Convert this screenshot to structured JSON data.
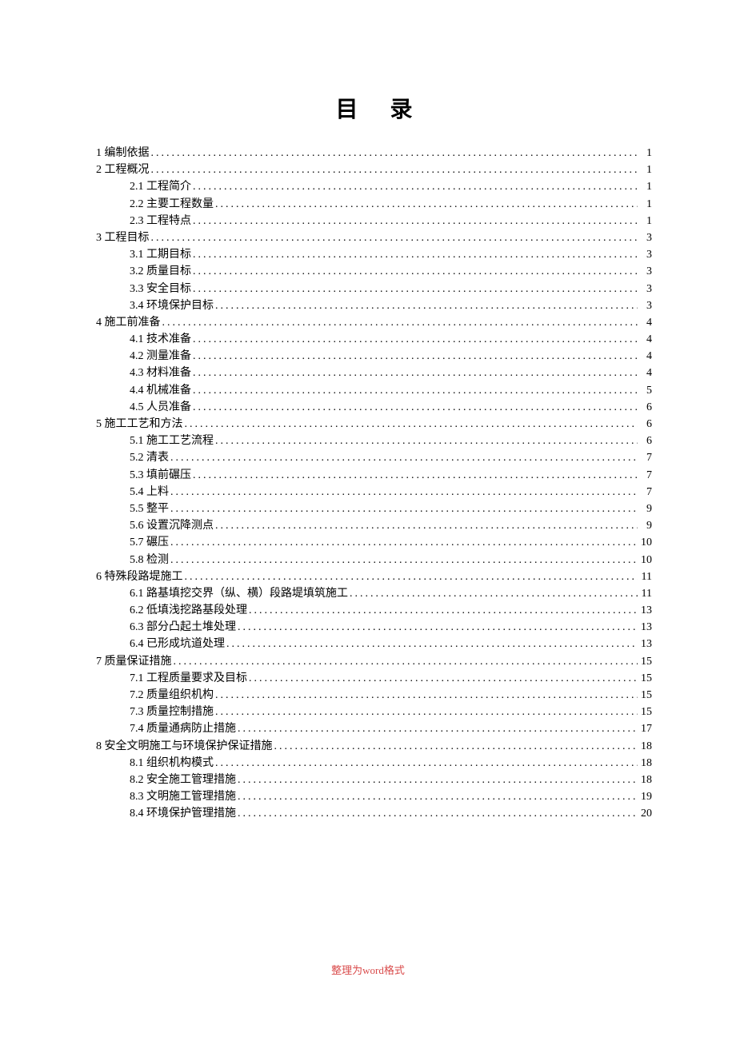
{
  "title": "目录",
  "footer_prefix": "整理为",
  "footer_word": "word",
  "footer_suffix": "格式",
  "toc": [
    {
      "level": 0,
      "label": "1 编制依据",
      "page": "1"
    },
    {
      "level": 0,
      "label": "2 工程概况",
      "page": "1"
    },
    {
      "level": 1,
      "label": "2.1 工程简介",
      "page": "1"
    },
    {
      "level": 1,
      "label": "2.2 主要工程数量",
      "page": "1"
    },
    {
      "level": 1,
      "label": "2.3 工程特点",
      "page": "1"
    },
    {
      "level": 0,
      "label": "3 工程目标",
      "page": "3"
    },
    {
      "level": 1,
      "label": "3.1 工期目标",
      "page": "3"
    },
    {
      "level": 1,
      "label": "3.2 质量目标",
      "page": "3"
    },
    {
      "level": 1,
      "label": "3.3 安全目标",
      "page": "3"
    },
    {
      "level": 1,
      "label": "3.4 环境保护目标",
      "page": "3"
    },
    {
      "level": 0,
      "label": "4 施工前准备",
      "page": "4"
    },
    {
      "level": 1,
      "label": "4.1 技术准备",
      "page": "4"
    },
    {
      "level": 1,
      "label": "4.2 测量准备",
      "page": "4"
    },
    {
      "level": 1,
      "label": "4.3 材料准备",
      "page": "4"
    },
    {
      "level": 1,
      "label": "4.4 机械准备",
      "page": "5"
    },
    {
      "level": 1,
      "label": "4.5 人员准备",
      "page": "6"
    },
    {
      "level": 0,
      "label": "5 施工工艺和方法",
      "page": "6"
    },
    {
      "level": 1,
      "label": "5.1 施工工艺流程",
      "page": "6"
    },
    {
      "level": 1,
      "label": "5.2  清表",
      "page": "7"
    },
    {
      "level": 1,
      "label": "5.3  填前碾压",
      "page": "7"
    },
    {
      "level": 1,
      "label": "5.4  上料",
      "page": "7"
    },
    {
      "level": 1,
      "label": "5.5  整平",
      "page": "9"
    },
    {
      "level": 1,
      "label": "5.6  设置沉降测点",
      "page": "9"
    },
    {
      "level": 1,
      "label": "5.7  碾压",
      "page": "10"
    },
    {
      "level": 1,
      "label": "5.8  检测",
      "page": "10"
    },
    {
      "level": 0,
      "label": "6 特殊段路堤施工",
      "page": "11"
    },
    {
      "level": 1,
      "label": "6.1 路基填挖交界（纵、横）段路堤填筑施工",
      "page": "11"
    },
    {
      "level": 1,
      "label": "6.2 低填浅挖路基段处理",
      "page": "13"
    },
    {
      "level": 1,
      "label": "6.3  部分凸起土堆处理",
      "page": "13"
    },
    {
      "level": 1,
      "label": "6.4 已形成坑道处理",
      "page": "13"
    },
    {
      "level": 0,
      "label": "7 质量保证措施",
      "page": "15"
    },
    {
      "level": 1,
      "label": "7.1 工程质量要求及目标",
      "page": "15"
    },
    {
      "level": 1,
      "label": "7.2  质量组织机构",
      "page": "15"
    },
    {
      "level": 1,
      "label": "7.3  质量控制措施",
      "page": "15"
    },
    {
      "level": 1,
      "label": "7.4 质量通病防止措施",
      "page": "17"
    },
    {
      "level": 0,
      "label": "8 安全文明施工与环境保护保证措施",
      "page": "18"
    },
    {
      "level": 1,
      "label": "8.1  组织机构模式",
      "page": "18"
    },
    {
      "level": 1,
      "label": "8.2  安全施工管理措施",
      "page": "18"
    },
    {
      "level": 1,
      "label": "8.3 文明施工管理措施",
      "page": "19"
    },
    {
      "level": 1,
      "label": "8.4  环境保护管理措施",
      "page": "20"
    }
  ]
}
